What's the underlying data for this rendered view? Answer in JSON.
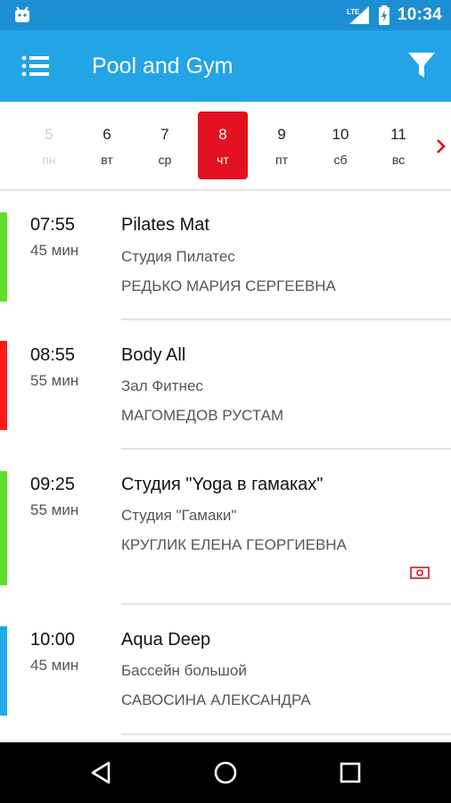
{
  "status_bar": {
    "network": "LTE",
    "time": "10:34",
    "icons": [
      "android-icon",
      "lte-signal-icon",
      "battery-charging-icon"
    ]
  },
  "app_bar": {
    "title": "Pool and Gym",
    "icons": [
      "menu-icon",
      "filter-icon"
    ]
  },
  "dates": [
    {
      "num": "5",
      "wd": "пн",
      "state": "disabled"
    },
    {
      "num": "6",
      "wd": "вт",
      "state": "normal"
    },
    {
      "num": "7",
      "wd": "ср",
      "state": "normal"
    },
    {
      "num": "8",
      "wd": "чт",
      "state": "selected"
    },
    {
      "num": "9",
      "wd": "пт",
      "state": "normal"
    },
    {
      "num": "10",
      "wd": "сб",
      "state": "normal"
    },
    {
      "num": "11",
      "wd": "вс",
      "state": "normal"
    }
  ],
  "sessions": [
    {
      "time": "07:55",
      "duration": "45 мин",
      "name": "Pilates Mat",
      "place": "Студия Пилатес",
      "coach": "РЕДЬКО МАРИЯ СЕРГЕЕВНА",
      "color": "#5ee02b",
      "paid": false
    },
    {
      "time": "08:55",
      "duration": "55 мин",
      "name": "Body All",
      "place": "Зал Фитнес",
      "coach": "МАГОМЕДОВ РУСТАМ",
      "color": "#ff1a1a",
      "paid": false
    },
    {
      "time": "09:25",
      "duration": "55 мин",
      "name": "Студия \"Yoga в гамаках\"",
      "place": "Студия \"Гамаки\"",
      "coach": "КРУГЛИК ЕЛЕНА ГЕОРГИЕВНА",
      "color": "#5ee02b",
      "paid": true
    },
    {
      "time": "10:00",
      "duration": "45 мин",
      "name": "Aqua Deep",
      "place": "Бассейн большой",
      "coach": "САВОСИНА АЛЕКСАНДРА",
      "color": "#1faae8",
      "paid": false
    }
  ],
  "colors": {
    "status_bar": "#1c8fd3",
    "app_bar": "#23a4e6",
    "selected_day": "#e3101f",
    "accent_red": "#e3101f"
  },
  "nav_bar": {
    "icons": [
      "back-icon",
      "home-icon",
      "recents-icon"
    ]
  }
}
